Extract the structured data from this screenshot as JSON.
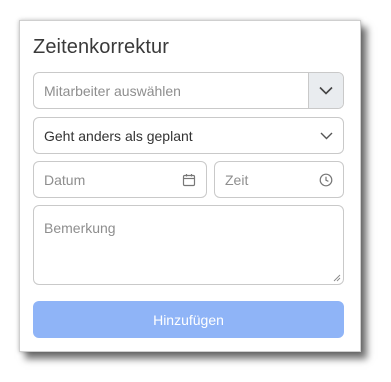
{
  "form": {
    "title": "Zeitenkorrektur",
    "employee_placeholder": "Mitarbeiter auswählen",
    "type_value": "Geht anders als geplant",
    "date_placeholder": "Datum",
    "time_placeholder": "Zeit",
    "remark_placeholder": "Bemerkung",
    "submit_label": "Hinzufügen"
  },
  "icons": {
    "employee_dropdown": "chevron-down-icon",
    "type_dropdown": "chevron-down-icon",
    "date": "calendar-icon",
    "time": "clock-icon"
  },
  "colors": {
    "submit_bg": "#8fb4f7",
    "border": "#c9c9c9"
  }
}
